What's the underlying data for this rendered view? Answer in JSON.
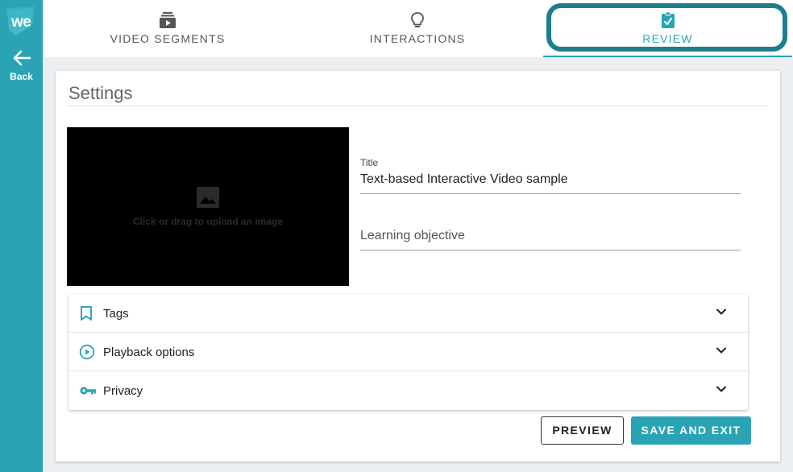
{
  "brand": {
    "logo_text": "we",
    "accent": "#2aa4b5",
    "highlight": "#1e7e8c"
  },
  "sidebar": {
    "back_label": "Back"
  },
  "tabs": [
    {
      "label": "VIDEO SEGMENTS",
      "icon": "video-stack-icon"
    },
    {
      "label": "INTERACTIONS",
      "icon": "lightbulb-icon"
    },
    {
      "label": "REVIEW",
      "icon": "clipboard-check-icon",
      "active": true
    }
  ],
  "settings": {
    "title": "Settings",
    "upload_label": "Click or drag to upload an image",
    "title_field": {
      "label": "Title",
      "value": "Text-based Interactive Video sample"
    },
    "objective_field": {
      "placeholder": "Learning objective"
    }
  },
  "accordion": [
    {
      "label": "Tags",
      "icon": "bookmark-icon"
    },
    {
      "label": "Playback options",
      "icon": "play-circle-icon"
    },
    {
      "label": "Privacy",
      "icon": "key-icon"
    }
  ],
  "actions": {
    "preview_label": "PREVIEW",
    "save_label": "SAVE AND EXIT"
  }
}
